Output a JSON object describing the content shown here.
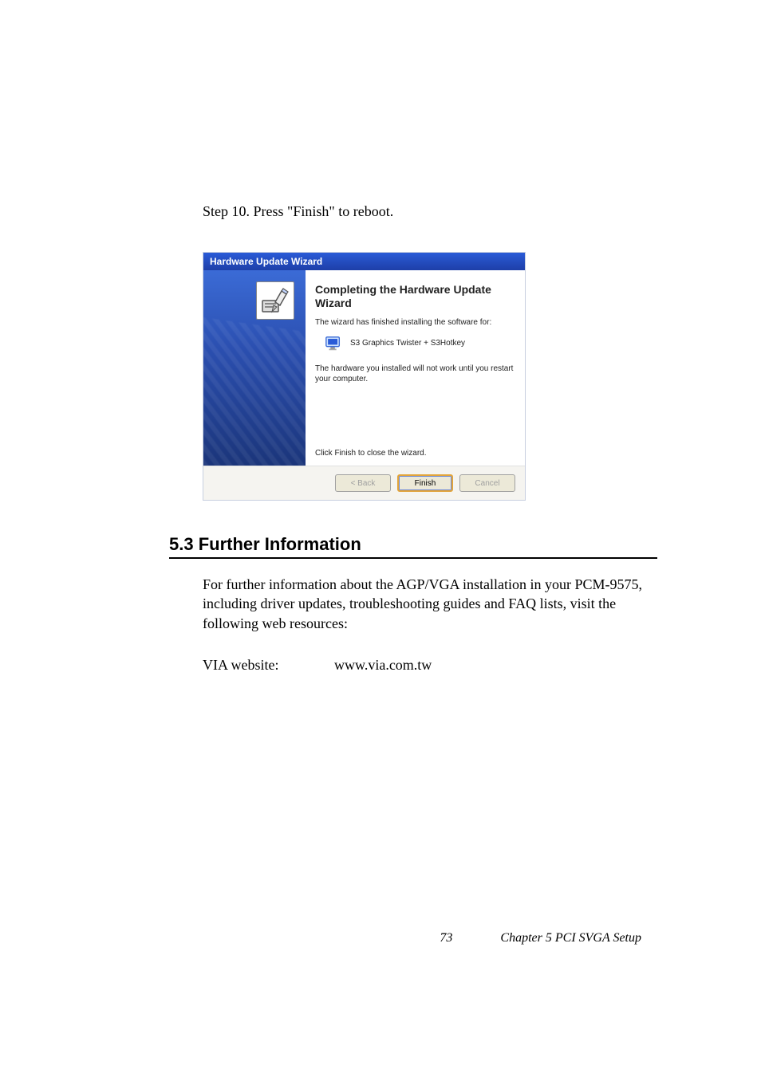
{
  "step": {
    "text": "Step 10.  Press \"Finish\" to reboot."
  },
  "dialog": {
    "title": "Hardware Update Wizard",
    "heading": "Completing the Hardware Update Wizard",
    "line1": "The wizard has finished installing the software for:",
    "device": "S3 Graphics Twister + S3Hotkey",
    "restart": "The hardware you installed will not work until you restart your computer.",
    "close": "Click Finish to close the wizard.",
    "buttons": {
      "back": "< Back",
      "finish": "Finish",
      "cancel": "Cancel"
    }
  },
  "section": {
    "title": "5.3  Further Information",
    "body": "For further information about the AGP/VGA installation in your PCM-9575, including driver updates, troubleshooting guides and FAQ lists, visit the following web resources:",
    "website_label": "VIA website:",
    "website_url": "www.via.com.tw"
  },
  "footer": {
    "page": "73",
    "chapter": "Chapter 5  PCI SVGA Setup"
  }
}
